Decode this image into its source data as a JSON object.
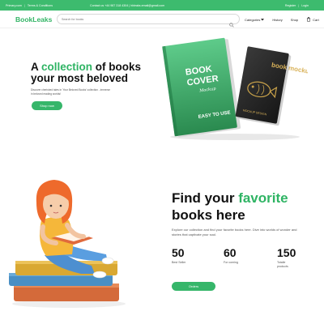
{
  "topbar": {
    "site_link": "Primary.com",
    "support_link": "Terms & Conditions",
    "contact": "Contact us +44 987 318 4304 | hbleaks.email@gmail.com",
    "register": "Register",
    "login": "Login",
    "color": "#3dbb6e"
  },
  "navbar": {
    "logo": "BookLeaks",
    "search_placeholder": "Search for books",
    "categories": "Categories",
    "history": "History",
    "shop": "Shop",
    "cart": "Cart"
  },
  "hero": {
    "title_pre": "A",
    "title_accent": "collection",
    "title_post": "of books your most beloved",
    "subtitle": "Discover cherished tales in 'Your Beloved Books' collection - immerse in beloved reading worlds!",
    "button": "Shop now",
    "book_left": {
      "line1": "BOOK",
      "line2": "COVER",
      "script": "Mockup",
      "footer": "EASY TO USE"
    },
    "book_right": {
      "title": "book mockup",
      "footer": "MOCKUP DESIGN"
    }
  },
  "section": {
    "title_pre": "Find your",
    "title_accent": "favorite",
    "title_post": "books here",
    "text": "Explore our collection and find your favorite books here. Dive into worlds of wonder and stories that captivate your soul.",
    "stats": [
      {
        "value": "50",
        "label": "Best Seller"
      },
      {
        "value": "60",
        "label": "For coming"
      },
      {
        "value": "150",
        "label": "Totalle products"
      }
    ],
    "button": "Orders"
  },
  "colors": {
    "accent": "#2fb464",
    "button": "#36b66a"
  }
}
